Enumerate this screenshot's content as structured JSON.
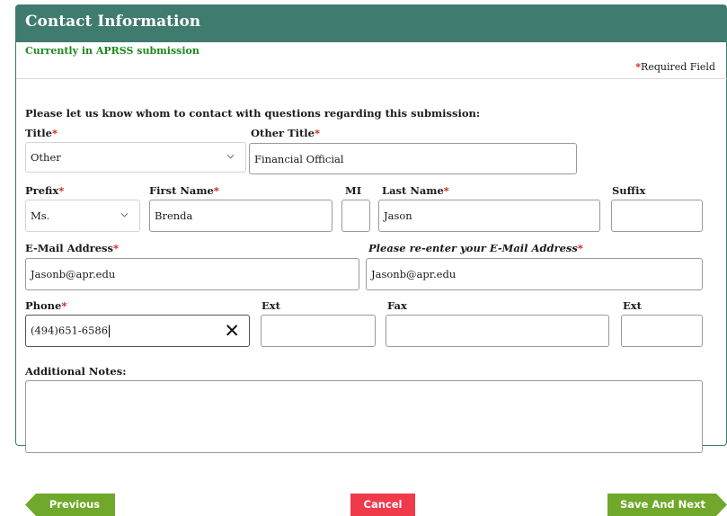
{
  "header": {
    "title": "Contact Information",
    "status": "Currently in APRSS submission",
    "required_label": "Required Field",
    "required_star": "*"
  },
  "form": {
    "instructions": "Please let us know whom to contact with questions regarding this submission:",
    "title": {
      "label": "Title",
      "value": "Other"
    },
    "other_title": {
      "label": "Other Title",
      "value": "Financial Official"
    },
    "prefix": {
      "label": "Prefix",
      "value": "Ms."
    },
    "first_name": {
      "label": "First Name",
      "value": "Brenda"
    },
    "mi": {
      "label": "MI",
      "value": ""
    },
    "last_name": {
      "label": "Last Name",
      "value": "Jason"
    },
    "suffix": {
      "label": "Suffix",
      "value": ""
    },
    "email": {
      "label": "E-Mail Address",
      "value": "Jasonb@apr.edu"
    },
    "email_confirm": {
      "label": "Please re-enter your E-Mail Address",
      "value": "Jasonb@apr.edu"
    },
    "phone": {
      "label": "Phone",
      "value": "(494)651-6586"
    },
    "phone_ext": {
      "label": "Ext",
      "value": ""
    },
    "fax": {
      "label": "Fax",
      "value": ""
    },
    "fax_ext": {
      "label": "Ext",
      "value": ""
    },
    "notes": {
      "label": "Additional Notes:",
      "value": ""
    }
  },
  "buttons": {
    "previous": "Previous",
    "cancel": "Cancel",
    "save_next": "Save And Next"
  },
  "colors": {
    "header_bg": "#3f7b6e",
    "status_text": "#1a8a1a",
    "required_star": "#d11818",
    "button_green": "#6fa82a",
    "button_red": "#f03a4a"
  }
}
